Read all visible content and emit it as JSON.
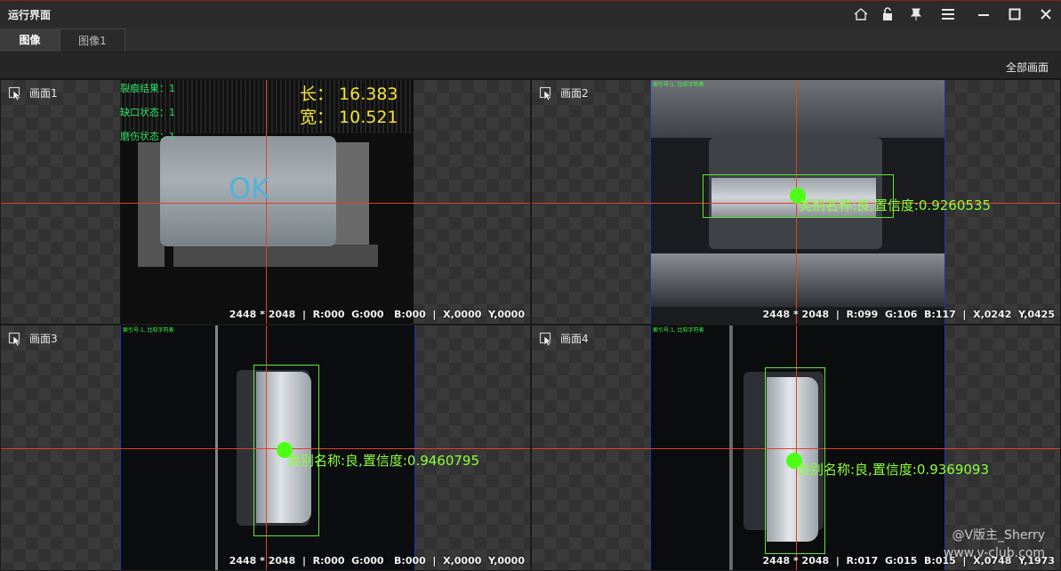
{
  "window": {
    "title": "运行界面"
  },
  "window_controls": [
    "home-icon",
    "unlock-icon",
    "pin-icon",
    "menu-icon",
    "minimize-icon",
    "maximize-icon",
    "close-icon"
  ],
  "tabs": [
    {
      "label": "图像",
      "active": true
    },
    {
      "label": "图像1",
      "active": false
    }
  ],
  "toolbar": {
    "all_screens": "全部画面"
  },
  "panes": {
    "p1": {
      "label": "画面1",
      "status": "2448 * 2048  |  R:000  G:000   B:000  |  X,0000  Y,0000",
      "crack": "裂痕结果：1",
      "notch": "缺口状态：1",
      "wear": "磨伤状态：1",
      "length": "长：  16.383",
      "width": "宽：  10.521",
      "verdict": "OK"
    },
    "p2": {
      "label": "画面2",
      "status": "2448 * 2048  |  R:099  G:106  B:117  |  X,0242  Y,0425",
      "index_note": "索引号:1, 比较字符表",
      "result": "类别名称:良,置信度:0.9260535"
    },
    "p3": {
      "label": "画面3",
      "status": "2448 * 2048  |  R:000  G:000   B:000  |  X,0000  Y,0000",
      "index_note": "索引号:1, 比较字符表",
      "result": "类别名称:良,置信度:0.9460795"
    },
    "p4": {
      "label": "画面4",
      "status": "2448 * 2048  |  R:017  G:015  B:015  |  X,0748  Y,1973",
      "index_note": "索引号:1, 比较字符表",
      "result": "类别名称:良,置信度:0.9369093"
    }
  },
  "watermark": {
    "line1": "@V版主_Sherry",
    "line2": "www.v-club.com"
  },
  "colors": {
    "crosshair": "#e0402a",
    "box": "#5fe830",
    "result_text": "#8cff3a",
    "measure_text": "#f5e23a",
    "status_green": "#2ee06a"
  }
}
